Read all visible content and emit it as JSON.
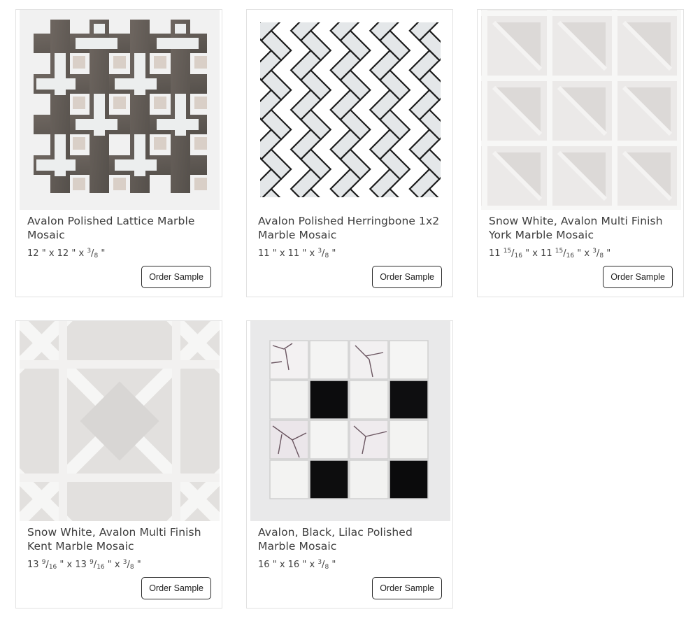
{
  "products": [
    {
      "title": "Avalon Polished Lattice Marble Mosaic",
      "size": {
        "w_whole": "12",
        "w_num": "",
        "w_den": "",
        "h_whole": "12",
        "h_num": "",
        "h_den": "",
        "t_num": "3",
        "t_den": "8"
      },
      "button_label": "Order Sample"
    },
    {
      "title": "Avalon Polished Herringbone 1x2 Marble Mosaic",
      "size": {
        "w_whole": "11",
        "w_num": "",
        "w_den": "",
        "h_whole": "11",
        "h_num": "",
        "h_den": "",
        "t_num": "3",
        "t_den": "8"
      },
      "button_label": "Order Sample"
    },
    {
      "title": "Snow White, Avalon Multi Finish York Marble Mosaic",
      "size": {
        "w_whole": "11",
        "w_num": "15",
        "w_den": "16",
        "h_whole": "11",
        "h_num": "15",
        "h_den": "16",
        "t_num": "3",
        "t_den": "8"
      },
      "button_label": "Order Sample"
    },
    {
      "title": "Snow White, Avalon Multi Finish Kent Marble Mosaic",
      "size": {
        "w_whole": "13",
        "w_num": "9",
        "w_den": "16",
        "h_whole": "13",
        "h_num": "9",
        "h_den": "16",
        "t_num": "3",
        "t_den": "8"
      },
      "button_label": "Order Sample"
    },
    {
      "title": "Avalon, Black, Lilac Polished Marble Mosaic",
      "size": {
        "w_whole": "16",
        "w_num": "",
        "w_den": "",
        "h_whole": "16",
        "h_num": "",
        "h_den": "",
        "t_num": "3",
        "t_den": "8"
      },
      "button_label": "Order Sample"
    }
  ],
  "size_labels": {
    "inch": "\"",
    "times": "x"
  }
}
